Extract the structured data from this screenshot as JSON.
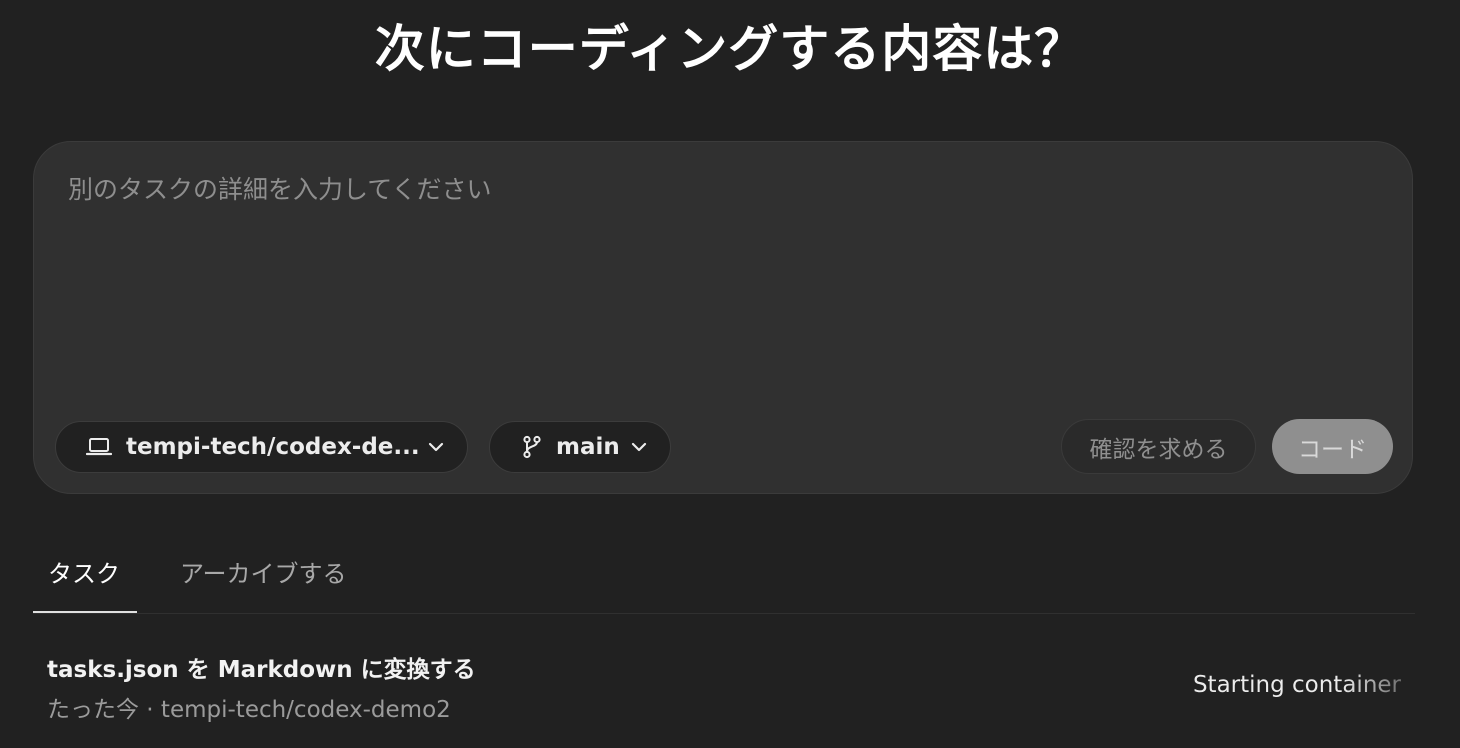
{
  "heading": "次にコーディングする内容は？",
  "composer": {
    "placeholder": "別のタスクの詳細を入力してください",
    "repo_label": "tempi-tech/codex-de...",
    "repo_icon": "laptop-icon",
    "branch_label": "main",
    "branch_icon": "git-branch-icon",
    "ask_button": "確認を求める",
    "code_button": "コード"
  },
  "tabs": [
    {
      "label": "タスク",
      "active": true
    },
    {
      "label": "アーカイブする",
      "active": false
    }
  ],
  "tasks": [
    {
      "title": "tasks.json を Markdown に変換する",
      "meta": "たった今 · tempi-tech/codex-demo2",
      "status": "Starting container"
    }
  ],
  "colors": {
    "background": "#212121",
    "composer_bg": "#303030",
    "code_button_bg": "#8f8f8f"
  }
}
